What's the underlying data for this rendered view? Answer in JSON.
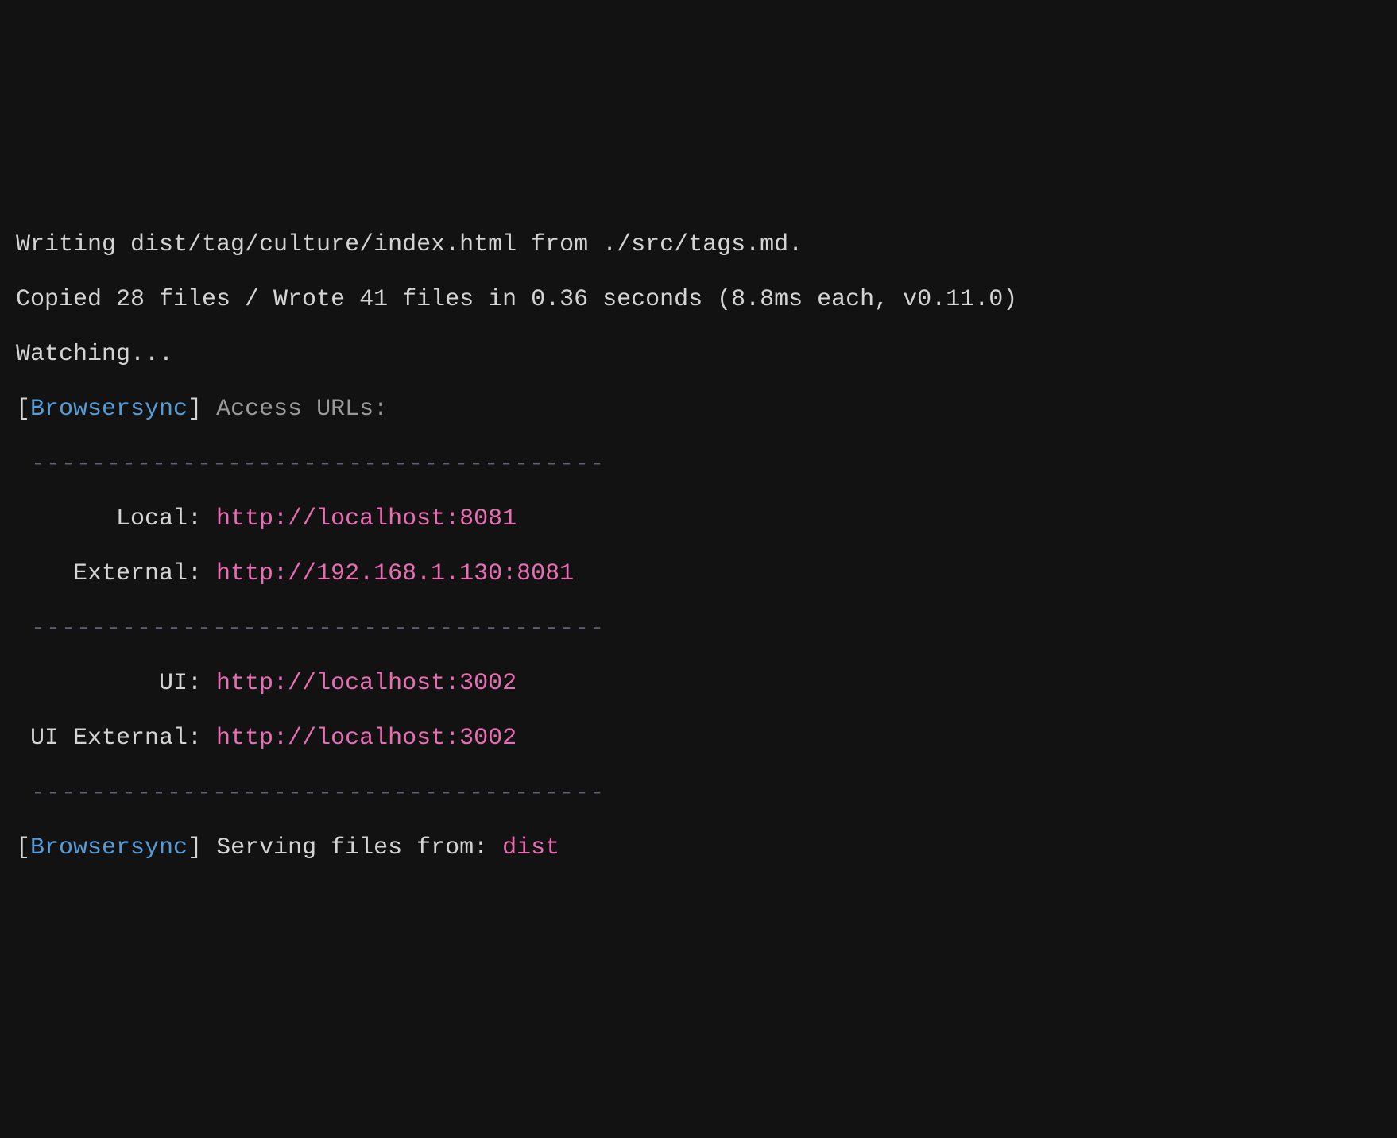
{
  "lines": {
    "writing": "Writing dist/tag/culture/index.html from ./src/tags.md.",
    "copied": "Copied 28 files / Wrote 41 files in 0.36 seconds (8.8ms each, v0.11.0)",
    "watching": "Watching...",
    "bracket_open": "[",
    "bracket_close": "]",
    "browsersync": "Browsersync",
    "access_urls": " Access URLs:",
    "dashes": " --------------------------------------",
    "local_label": "       Local: ",
    "local_url": "http://localhost:8081",
    "external_label": "    External: ",
    "external_url": "http://192.168.1.130:8081",
    "ui_label": "          UI: ",
    "ui_url": "http://localhost:3002",
    "ui_external_label": " UI External: ",
    "ui_external_url": "http://localhost:3002",
    "serving": " Serving files from: ",
    "dist": "dist"
  }
}
